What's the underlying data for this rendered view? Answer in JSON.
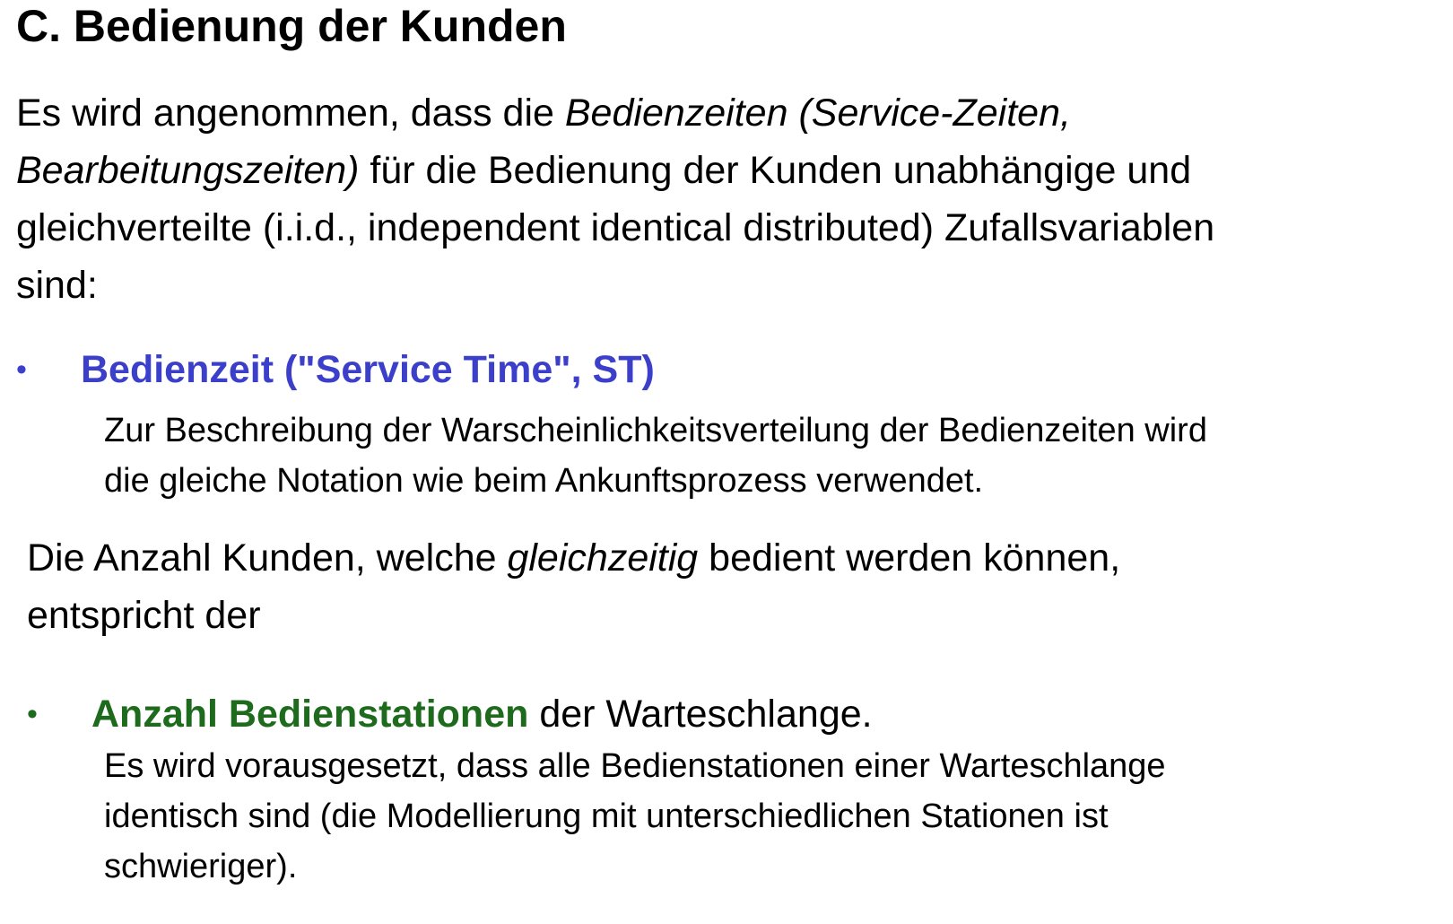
{
  "heading": "C. Bedienung der Kunden",
  "intro": {
    "line1_plain": "Es wird angenommen, dass die ",
    "line1_italic": "Bedienzeiten (Service-Zeiten,",
    "line2_italic": "Bearbeitungszeiten)",
    "line2_plain": " für die Bedienung der Kunden unabhängige und",
    "line3": "gleichverteilte (i.i.d., independent identical distributed) Zufallsvariablen",
    "line4": "sind:"
  },
  "bullet1": {
    "marker": "•",
    "label": "Bedienzeit (\"Service Time\", ST)",
    "description_line1": "Zur Beschreibung der Warscheinlichkeitsverteilung der Bedienzeiten wird",
    "description_line2": "die gleiche Notation wie beim Ankunftsprozess verwendet."
  },
  "para2": {
    "line1_plain_a": "Die Anzahl Kunden, welche ",
    "line1_italic": "gleichzeitig",
    "line1_plain_b": " bedient werden können,",
    "line2": "entspricht der"
  },
  "bullet2": {
    "marker": "•",
    "term": "Anzahl Bedienstationen",
    "rest": " der Warteschlange.",
    "description_line1": "Es wird vorausgesetzt, dass alle Bedienstationen einer Warteschlange",
    "description_line2": "identisch sind (die Modellierung mit unterschiedlichen Stationen ist",
    "description_line3": "schwieriger)."
  },
  "colors": {
    "bullet1_accent": "#3b3fc9",
    "bullet2_accent": "#1e6b1e",
    "text": "#000000",
    "background": "#ffffff"
  }
}
